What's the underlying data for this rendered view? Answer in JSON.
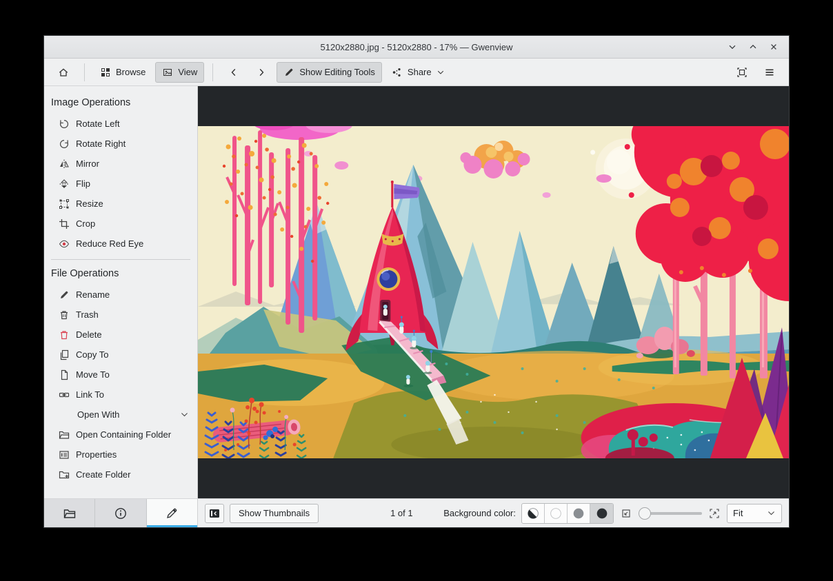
{
  "window": {
    "title": "5120x2880.jpg - 5120x2880 - 17% — Gwenview"
  },
  "toolbar": {
    "browse_label": "Browse",
    "view_label": "View",
    "editing_tools_label": "Show Editing Tools",
    "share_label": "Share"
  },
  "sidebar": {
    "sections": [
      {
        "title": "Image Operations",
        "items": [
          {
            "label": "Rotate Left"
          },
          {
            "label": "Rotate Right"
          },
          {
            "label": "Mirror"
          },
          {
            "label": "Flip"
          },
          {
            "label": "Resize"
          },
          {
            "label": "Crop"
          },
          {
            "label": "Reduce Red Eye"
          }
        ]
      },
      {
        "title": "File Operations",
        "items": [
          {
            "label": "Rename"
          },
          {
            "label": "Trash"
          },
          {
            "label": "Delete"
          },
          {
            "label": "Copy To"
          },
          {
            "label": "Move To"
          },
          {
            "label": "Link To"
          },
          {
            "label": "Open With"
          },
          {
            "label": "Open Containing Folder"
          },
          {
            "label": "Properties"
          },
          {
            "label": "Create Folder"
          }
        ]
      }
    ]
  },
  "statusbar": {
    "show_thumbnails_label": "Show Thumbnails",
    "counter": "1 of 1",
    "background_color_label": "Background color:",
    "zoom_mode_value": "Fit"
  },
  "colors": {
    "accent": "#3daee9",
    "danger": "#da4453",
    "viewer_background": "#232629"
  }
}
